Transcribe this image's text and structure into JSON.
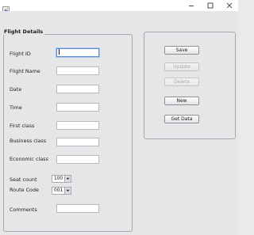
{
  "window": {
    "icons": {
      "app": "java-app-icon",
      "minimize": "minimize-icon",
      "maximize": "maximize-icon",
      "close": "close-icon"
    }
  },
  "form": {
    "section_title": "Flight Details",
    "labels": {
      "flight_id": "Flight ID",
      "flight_name": "Flight Name",
      "date": "Date",
      "time": "Time",
      "first_class": "First class",
      "business_class": "Business class",
      "economic_class": "Economic class",
      "seat_count": "Seat count",
      "route_code": "Route Code",
      "comments": "Comments"
    },
    "values": {
      "flight_id": "",
      "flight_name": "",
      "date": "",
      "time": "",
      "first_class": "",
      "business_class": "",
      "economic_class": "",
      "comments": ""
    },
    "seat_count_selected": "100",
    "route_code_selected": "001"
  },
  "actions": {
    "save": "Save",
    "update": "Update",
    "delete": "Delete",
    "new": "New",
    "get_data": "Get Data"
  },
  "colors": {
    "background": "#e6e6e9",
    "panel_border": "#a7a7ad",
    "focus": "#5b8ed6",
    "disabled_text": "#a9a9b0"
  }
}
